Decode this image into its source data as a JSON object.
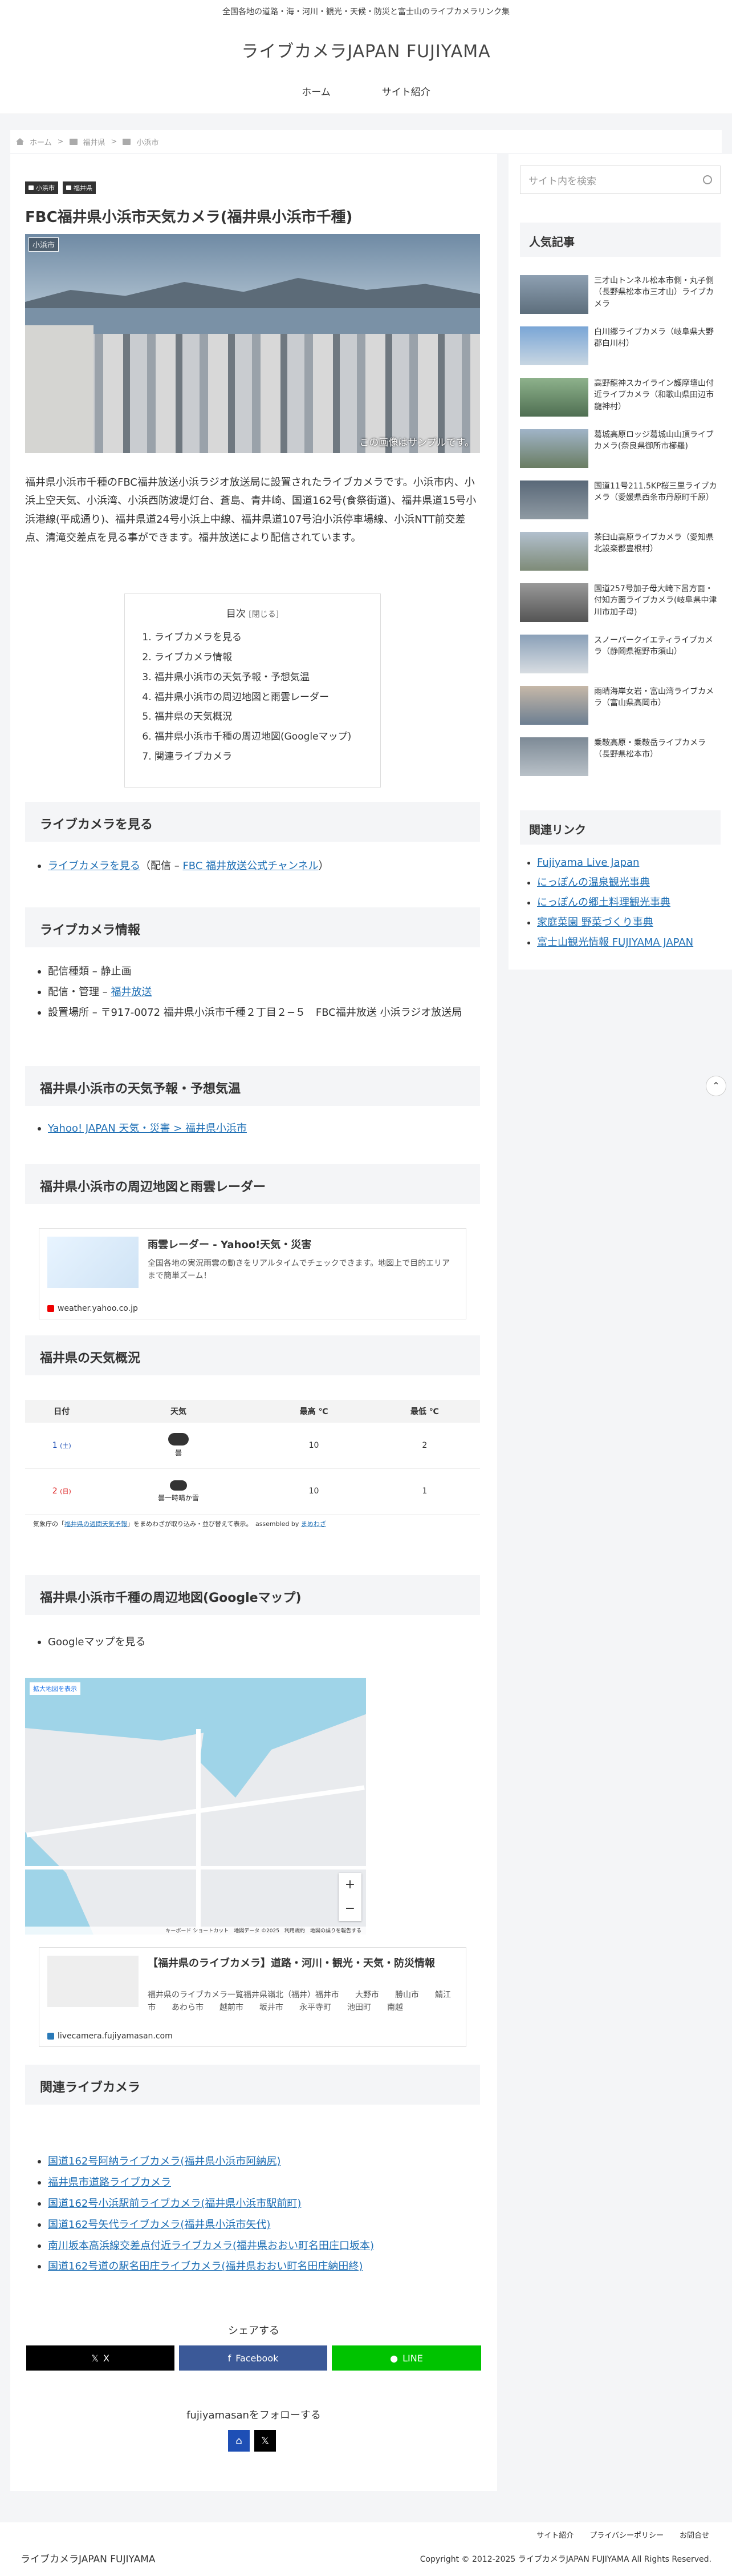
{
  "topbar": {
    "text": "全国各地の道路・海・河川・観光・天候・防災と富士山のライブカメラリンク集"
  },
  "site": {
    "title": "ライブカメラJAPAN FUJIYAMA"
  },
  "nav": {
    "items": [
      {
        "label": "ホーム"
      },
      {
        "label": "サイト紹介"
      }
    ]
  },
  "breadcrumb": {
    "items": [
      {
        "label": "ホーム"
      },
      {
        "label": "福井県"
      },
      {
        "label": "小浜市"
      }
    ]
  },
  "article": {
    "categories": [
      {
        "label": "小浜市"
      },
      {
        "label": "福井県"
      }
    ],
    "title": "FBC福井県小浜市天気カメラ(福井県小浜市千種)",
    "hero_tag": "小浜市",
    "hero_note": "この画像はサンプルです。",
    "intro": "福井県小浜市千種のFBC福井放送小浜ラジオ放送局に設置されたライブカメラです。小浜市内、小浜上空天気、小浜湾、小浜西防波堤灯台、蒼島、青井崎、国道162号(食祭街道)、福井県道15号小浜港線(平成通り)、福井県道24号小浜上中線、福井県道107号泊小浜停車場線、小浜NTT前交差点、清滝交差点を見る事ができます。福井放送により配信されています。"
  },
  "toc": {
    "title": "目次",
    "toggle": "[閉じる]",
    "items": [
      "ライブカメラを見る",
      "ライブカメラ情報",
      "福井県小浜市の天気予報・予想気温",
      "福井県小浜市の周辺地図と雨雲レーダー",
      "福井県の天気概況",
      "福井県小浜市千種の周辺地図(Googleマップ)",
      "関連ライブカメラ"
    ]
  },
  "sections": {
    "watch": {
      "heading": "ライブカメラを見る",
      "link": "ライブカメラを見る",
      "dist_pre": "（配信 – ",
      "dist_link": "FBC 福井放送公式チャンネル",
      "dist_post": "）"
    },
    "info": {
      "heading": "ライブカメラ情報",
      "items": [
        {
          "text": "配信種類 – 静止画"
        },
        {
          "pre": "配信・管理 – ",
          "link": "福井放送"
        },
        {
          "text": "設置場所 – 〒917-0072 福井県小浜市千種２丁目２−５　FBC福井放送 小浜ラジオ放送局"
        }
      ]
    },
    "forecast": {
      "heading": "福井県小浜市の天気予報・予想気温",
      "link": "Yahoo! JAPAN 天気・災害 > 福井県小浜市"
    },
    "radar": {
      "heading": "福井県小浜市の周辺地図と雨雲レーダー",
      "card_title": "雨雲レーダー - Yahoo!天気・災害",
      "card_desc": "全国各地の実況雨雲の動きをリアルタイムでチェックできます。地図上で目的エリアまで簡単ズーム！",
      "card_url": "weather.yahoo.co.jp"
    },
    "overview": {
      "heading": "福井県の天気概況"
    },
    "gmap": {
      "heading": "福井県小浜市千種の周辺地図(Googleマップ)",
      "item": "Googleマップを見る",
      "map_label": "拡大地図を表示",
      "map_footer": "キーボード ショートカット　地図データ ©2025　利用規約　地図の誤りを報告する"
    },
    "fujiyama_card": {
      "title": "【福井県のライブカメラ】道路・河川・観光・天気・防災情報",
      "desc": "福井県のライブカメラ一覧福井県嶺北（福井）福井市　　大野市　　勝山市　　鯖江市　　あわら市　　越前市　　坂井市　　永平寺町　　池田町　　南越",
      "url": "livecamera.fujiyamasan.com"
    },
    "related": {
      "heading": "関連ライブカメラ",
      "items": [
        "国道162号阿納ライブカメラ(福井県小浜市阿納尻)",
        "福井県市道路ライブカメラ",
        "国道162号小浜駅前ライブカメラ(福井県小浜市駅前町)",
        "国道162号矢代ライブカメラ(福井県小浜市矢代)",
        "南川坂本高浜線交差点付近ライブカメラ(福井県おおい町名田庄口坂本)",
        "国道162号道の駅名田庄ライブカメラ(福井県おおい町名田庄納田終)"
      ]
    }
  },
  "weather": {
    "headers": [
      "日付",
      "天気",
      "最高 ℃",
      "最低 ℃"
    ],
    "rows": [
      {
        "day": "1",
        "dow": "(土)",
        "desc": "曇",
        "high": "10",
        "low": "2"
      },
      {
        "day": "2",
        "dow": "(日)",
        "desc": "曇一時晴か雪",
        "high": "10",
        "low": "1"
      }
    ],
    "source_pre": "気象庁の「",
    "source_link": "福井県の週間天気予報",
    "source_mid": "」をまめわざが取り込み・並び替えて表示。　assembled by ",
    "source_link2": "まめわざ"
  },
  "share": {
    "title": "シェアする",
    "buttons": [
      {
        "label": "X",
        "color": "#000000"
      },
      {
        "label": "Facebook",
        "color": "#3b5998"
      },
      {
        "label": "LINE",
        "color": "#00c300"
      }
    ]
  },
  "follow": {
    "title": "fujiyamasanをフォローする"
  },
  "sidebar": {
    "search_placeholder": "サイト内を検索",
    "popular_heading": "人気記事",
    "popular": [
      "三才山トンネル松本市側・丸子側（長野県松本市三才山）ライブカメラ",
      "白川郷ライブカメラ（岐阜県大野郡白川村）",
      "高野龍神スカイライン護摩壇山付近ライブカメラ（和歌山県田辺市龍神村）",
      "葛城高原ロッジ葛城山山頂ライブカメラ(奈良県御所市櫛羅)",
      "国道11号211.5KP桜三里ライブカメラ（愛媛県西条市丹原町千原）",
      "茶臼山高原ライブカメラ（愛知県北設楽郡豊根村）",
      "国道257号加子母大崎下呂方面・付知方面ライブカメラ(岐阜県中津川市加子母)",
      "スノーパークイエティライブカメラ（静岡県裾野市須山）",
      "雨晴海岸女岩・富山湾ライブカメラ（富山県高岡市）",
      "乗鞍高原・乗鞍岳ライブカメラ（長野県松本市）"
    ],
    "links_heading": "関連リンク",
    "links": [
      "Fujiyama Live Japan",
      "にっぽんの温泉観光事典",
      "にっぽんの郷土料理観光事典",
      "家庭菜園 野菜づくり事典",
      "富士山観光情報 FUJIYAMA JAPAN"
    ]
  },
  "footer": {
    "links": [
      "サイト紹介",
      "プライバシーポリシー",
      "お問合せ"
    ],
    "title": "ライブカメラJAPAN FUJIYAMA",
    "copyright": "Copyright © 2012-2025 ライブカメラJAPAN FUJIYAMA All Rights Reserved."
  }
}
